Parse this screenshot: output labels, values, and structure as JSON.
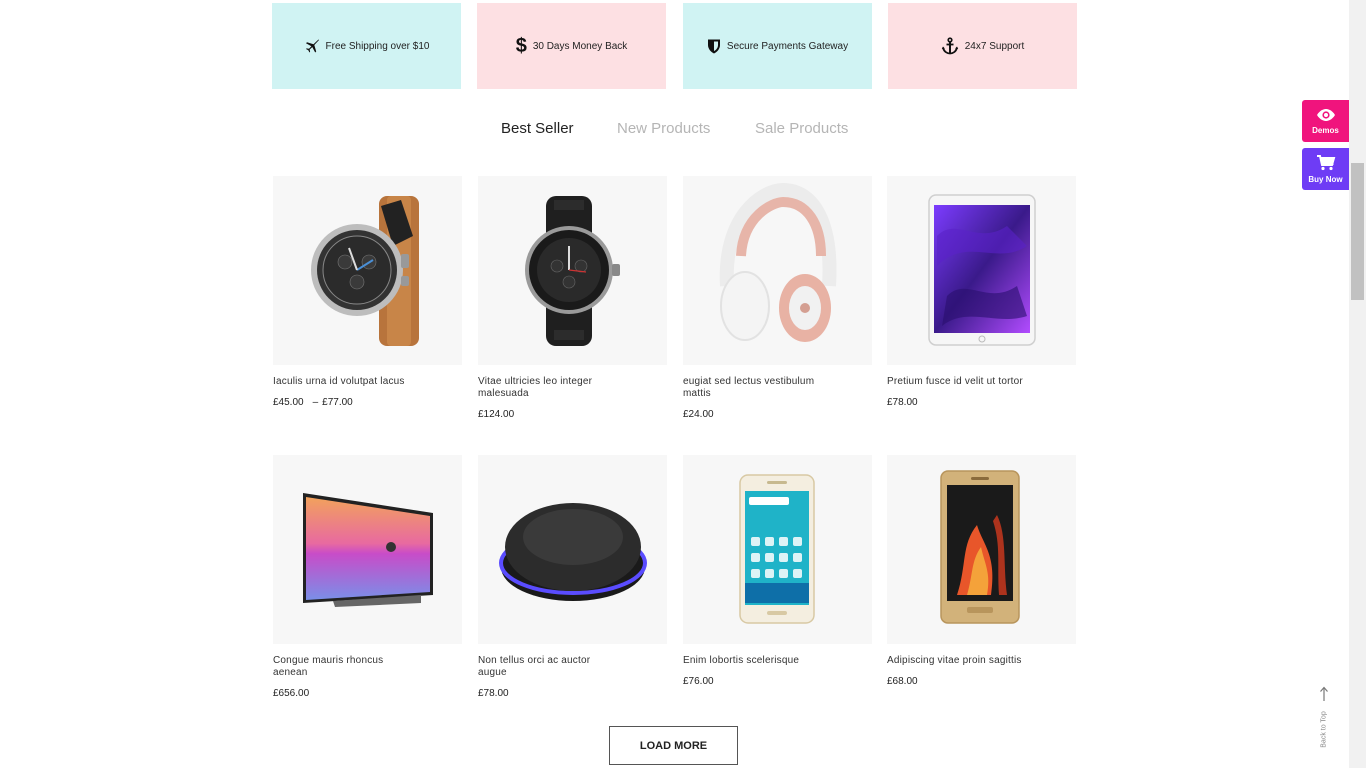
{
  "features": [
    {
      "label": "Free Shipping over $10",
      "icon": "plane-icon",
      "bg": "#d0f3f3"
    },
    {
      "label": "30 Days Money Back",
      "icon": "dollar-icon",
      "bg": "#fde0e3"
    },
    {
      "label": "Secure Payments Gateway",
      "icon": "shield-icon",
      "bg": "#d0f3f3"
    },
    {
      "label": "24x7 Support",
      "icon": "anchor-icon",
      "bg": "#fde0e3"
    }
  ],
  "tabs": [
    {
      "label": "Best Seller",
      "active": true
    },
    {
      "label": "New Products",
      "active": false
    },
    {
      "label": "Sale Products",
      "active": false
    }
  ],
  "products": [
    {
      "name": "Iaculis urna id volutpat lacus",
      "price": "£45.00",
      "price_max": "£77.00",
      "image": "smartwatch-brown-strap"
    },
    {
      "name": "Vitae ultricies leo integer malesuada",
      "price": "£124.00",
      "image": "smartwatch-black"
    },
    {
      "name": "eugiat sed lectus vestibulum mattis",
      "price": "£24.00",
      "image": "headphones-rose-gold"
    },
    {
      "name": "Pretium fusce id velit ut tortor",
      "price": "£78.00",
      "image": "tablet-purple"
    },
    {
      "name": "Congue mauris rhoncus aenean",
      "price": "£656.00",
      "image": "television"
    },
    {
      "name": "Non tellus orci ac auctor augue",
      "price": "£78.00",
      "image": "wireless-charger"
    },
    {
      "name": "Enim lobortis scelerisque",
      "price": "£76.00",
      "image": "smartphone-white"
    },
    {
      "name": "Adipiscing vitae proin sagittis",
      "price": "£68.00",
      "image": "smartphone-gold"
    }
  ],
  "load_more_label": "LOAD MORE",
  "side_buttons": {
    "demos": "Demos",
    "buy_now": "Buy Now"
  },
  "back_to_top": "Back to Top",
  "colors": {
    "cyan_bg": "#d0f3f3",
    "pink_bg": "#fde0e3",
    "demos": "#f0147d",
    "buy_now": "#6e3cf5"
  }
}
